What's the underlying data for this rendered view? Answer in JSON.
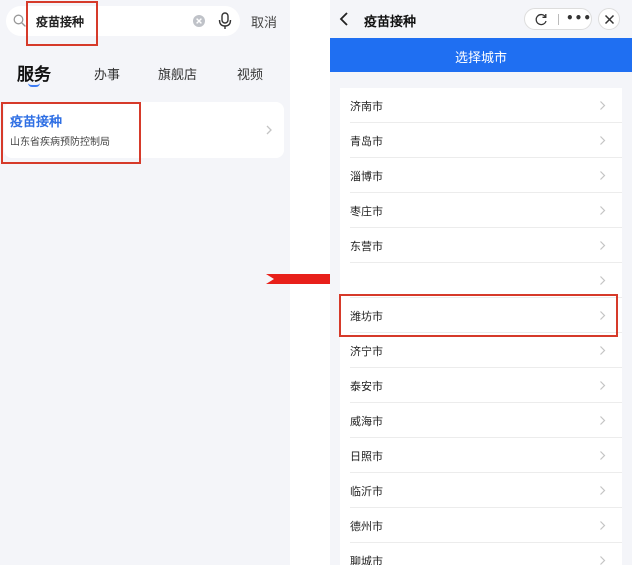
{
  "left_panel": {
    "search": {
      "value": "疫苗接种",
      "cancel_label": "取消"
    },
    "tabs": [
      {
        "label": "服务",
        "active": true
      },
      {
        "label": "办事",
        "active": false
      },
      {
        "label": "旗舰店",
        "active": false
      },
      {
        "label": "视频",
        "active": false
      }
    ],
    "result": {
      "title": "疫苗接种",
      "subtitle": "山东省疾病预防控制局"
    }
  },
  "right_panel": {
    "topbar": {
      "title": "疫苗接种"
    },
    "header_title": "选择城市",
    "cities": [
      "济南市",
      "青岛市",
      "淄博市",
      "枣庄市",
      "东营市",
      "",
      "潍坊市",
      "济宁市",
      "泰安市",
      "威海市",
      "日照市",
      "临沂市",
      "德州市",
      "聊城市"
    ]
  },
  "colors": {
    "accent_blue": "#1f6ff2",
    "link_blue": "#2f6fe4",
    "highlight_red": "#d63a2a",
    "arrow_red": "#e8201a",
    "panel_bg": "#f4f5f9"
  },
  "icons": [
    "search-icon",
    "clear-icon",
    "mic-icon",
    "chevron-right-icon",
    "back-icon",
    "refresh-icon",
    "more-icon",
    "close-icon",
    "arrow-right-icon"
  ]
}
